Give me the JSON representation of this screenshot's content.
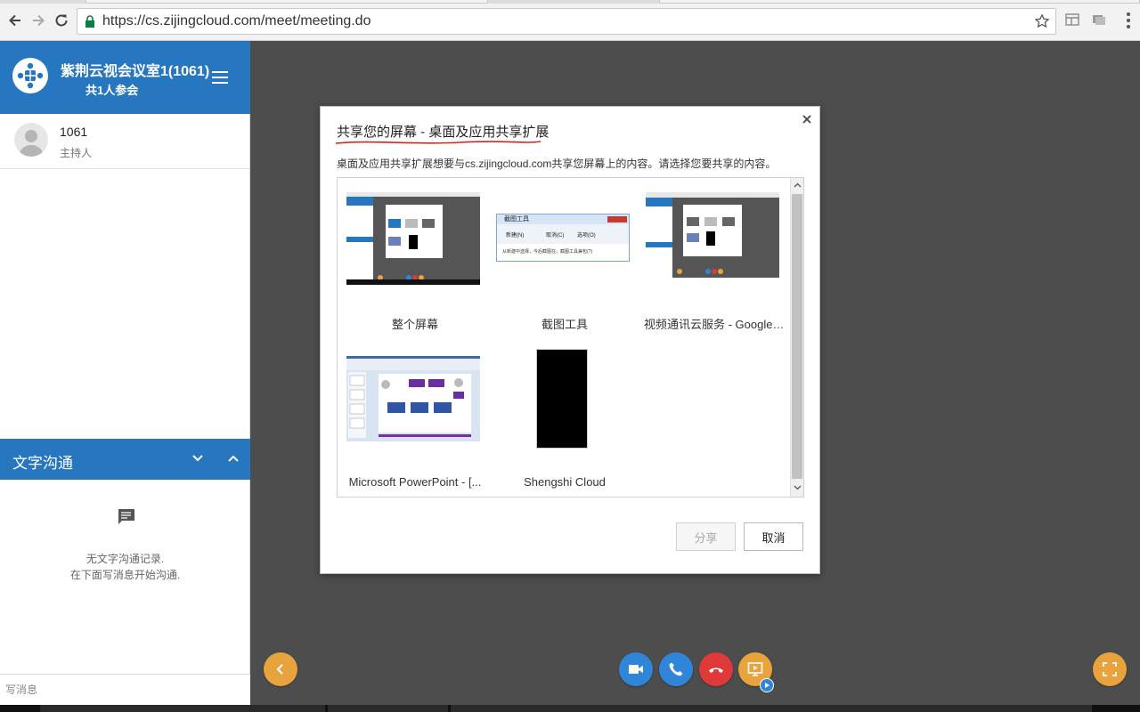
{
  "browser": {
    "url": "https://cs.zijingcloud.com/meet/meeting.do"
  },
  "sidebar": {
    "room_title": "紫荆云视会议室1(1061)",
    "participant_count": "共1人参会",
    "participants": [
      {
        "name": "1061",
        "role": "主持人"
      }
    ],
    "chat": {
      "title": "文字沟通",
      "empty_line1": "无文字沟通记录.",
      "empty_line2": "在下面写消息开始沟通.",
      "input_placeholder": "写消息"
    }
  },
  "dialog": {
    "title": "共享您的屏幕 - 桌面及应用共享扩展",
    "description": "桌面及应用共享扩展想要与cs.zijingcloud.com共享您屏幕上的内容。请选择您要共享的内容。",
    "sources": [
      {
        "label": "整个屏幕"
      },
      {
        "label": "截图工具"
      },
      {
        "label": "视频通讯云服务 - Google C..."
      },
      {
        "label": "Microsoft PowerPoint - [..."
      },
      {
        "label": "Shengshi Cloud"
      }
    ],
    "snip_tool": {
      "window_title": "截图工具",
      "new_label": "新建(N)",
      "cancel_label": "取消(C)",
      "options_label": "选项(O)",
      "hint": "从新建中选择，今后截图在，截图工具兼包(?)"
    },
    "share_label": "分享",
    "cancel_label": "取消"
  },
  "colors": {
    "brand_blue": "#2677bf",
    "accent_orange": "#e8a33c",
    "call_blue": "#2f86d9",
    "hangup_red": "#e0393a",
    "stage_gray": "#4d4d4d"
  }
}
